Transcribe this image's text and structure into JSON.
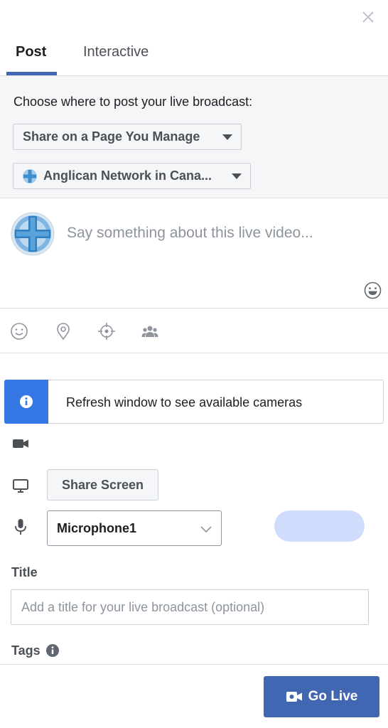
{
  "tabs": [
    {
      "label": "Post",
      "active": true
    },
    {
      "label": "Interactive",
      "active": false
    }
  ],
  "post_target": {
    "prompt": "Choose where to post your live broadcast:",
    "share_option": "Share on a Page You Manage",
    "page_name": "Anglican Network in Cana..."
  },
  "composer": {
    "placeholder": "Say something about this live video..."
  },
  "notice": {
    "text": "Refresh window to see available cameras"
  },
  "sources": {
    "share_screen_label": "Share Screen",
    "microphone_selected": "Microphone1"
  },
  "title_field": {
    "label": "Title",
    "placeholder": "Add a title for your live broadcast (optional)"
  },
  "tags": {
    "label": "Tags"
  },
  "footer": {
    "go_live_label": "Go Live"
  },
  "colors": {
    "accent": "#4267b2",
    "info_blue": "#3578e5",
    "level_pill": "#cfdcfb"
  },
  "icons": [
    "close-icon",
    "smiley-icon",
    "feeling-icon",
    "location-pin-icon",
    "target-icon",
    "people-icon",
    "info-icon",
    "video-camera-icon",
    "monitor-icon",
    "microphone-icon",
    "chevron-down-icon",
    "help-info-icon",
    "go-live-camera-icon"
  ]
}
